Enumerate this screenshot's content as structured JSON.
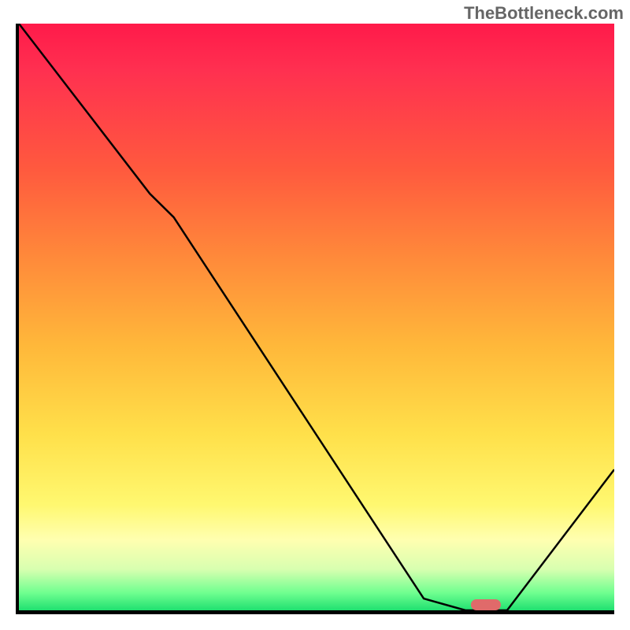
{
  "watermark": "TheBottleneck.com",
  "chart_data": {
    "type": "line",
    "title": "",
    "xlabel": "",
    "ylabel": "",
    "xlim": [
      0,
      100
    ],
    "ylim": [
      0,
      100
    ],
    "x": [
      0,
      22,
      26,
      68,
      75,
      82,
      100
    ],
    "values": [
      100,
      71,
      67,
      2,
      0,
      0,
      24
    ],
    "marker_x": 78,
    "marker_y": 0,
    "gradient_stops": [
      {
        "pos": 0,
        "color": "#ff1a4a"
      },
      {
        "pos": 70,
        "color": "#ffe04a"
      },
      {
        "pos": 100,
        "color": "#20e070"
      }
    ]
  }
}
